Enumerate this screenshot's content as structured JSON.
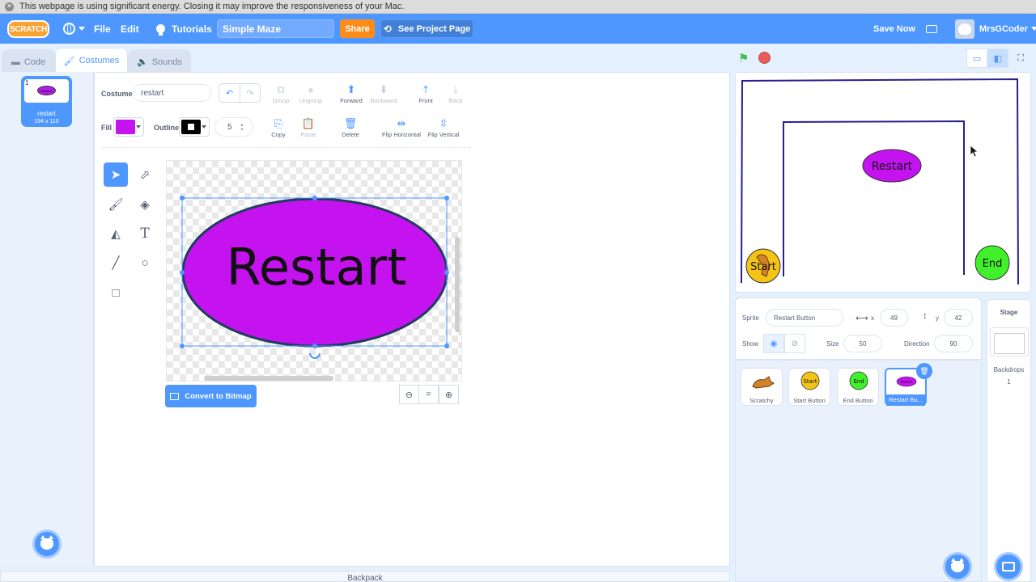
{
  "system_banner": {
    "text": "This webpage is using significant energy. Closing it may improve the responsiveness of your Mac."
  },
  "menubar": {
    "logo": "SCRATCH",
    "file": "File",
    "edit": "Edit",
    "tutorials": "Tutorials",
    "project_title": "Simple Maze",
    "share": "Share",
    "see_project_page": "See Project Page",
    "save_now": "Save Now",
    "username": "MrsGCoder"
  },
  "tabs": {
    "code": "Code",
    "costumes": "Costumes",
    "sounds": "Sounds"
  },
  "costume_list": [
    {
      "number": "1",
      "name": "restart",
      "size": "194 x 110",
      "thumb_text": "Restart"
    }
  ],
  "paint_editor": {
    "costume_label": "Costume",
    "costume_name": "restart",
    "group": "Group",
    "ungroup": "Ungroup",
    "forward": "Forward",
    "backward": "Backward",
    "front": "Front",
    "back": "Back",
    "fill_label": "Fill",
    "outline_label": "Outline",
    "outline_width": "5",
    "copy": "Copy",
    "paste": "Paste",
    "delete": "Delete",
    "flip_horizontal": "Flip Horizontal",
    "flip_vertical": "Flip Vertical",
    "canvas_text": "Restart",
    "convert_button": "Convert to Bitmap",
    "zoom_reset": "="
  },
  "colors": {
    "fill": "#c513f0",
    "outline": "#000000",
    "accent": "#4d97ff",
    "share": "#ff8c1a"
  },
  "backpack": "Backpack",
  "stage": {
    "restart_label": "Restart",
    "start_label": "Start",
    "end_label": "End"
  },
  "sprite_info": {
    "sprite_label": "Sprite",
    "sprite_name": "Restart Button",
    "x_label": "x",
    "x_value": "49",
    "y_label": "y",
    "y_value": "42",
    "show_label": "Show",
    "size_label": "Size",
    "size_value": "50",
    "direction_label": "Direction",
    "direction_value": "90"
  },
  "sprites": [
    {
      "name": "Scratchy"
    },
    {
      "name": "Start Button",
      "thumb_text": "Start"
    },
    {
      "name": "End Button",
      "thumb_text": "End"
    },
    {
      "name": "Restart Bu...",
      "thumb_text": "Restart"
    }
  ],
  "stage_pane": {
    "title": "Stage",
    "backdrops_label": "Backdrops",
    "backdrops_count": "1"
  }
}
